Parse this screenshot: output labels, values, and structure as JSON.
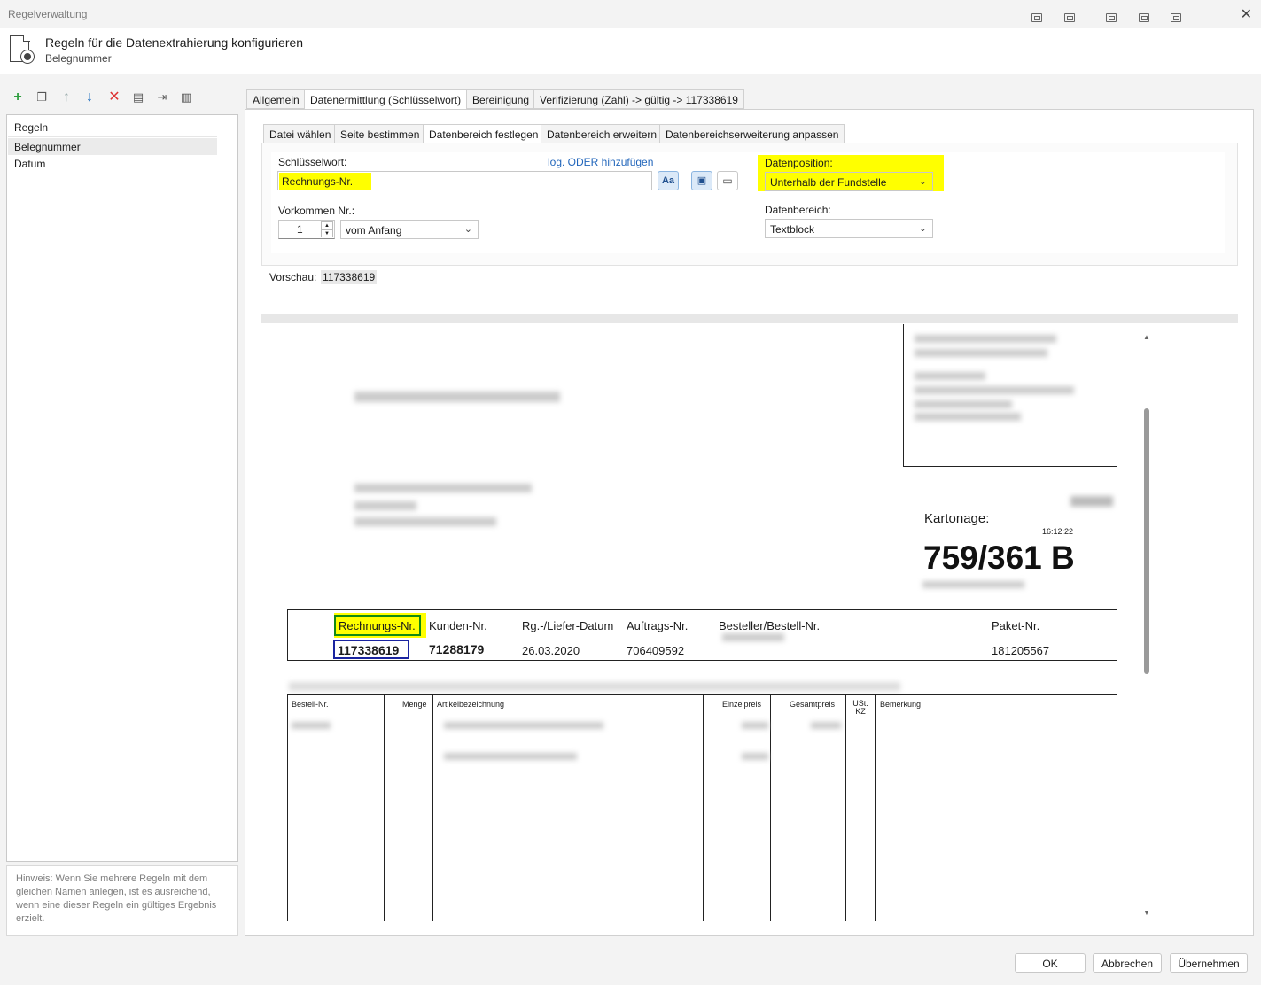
{
  "window": {
    "title": "Regelverwaltung",
    "header_title": "Regeln für die Datenextrahierung konfigurieren",
    "header_subtitle": "Belegnummer"
  },
  "left": {
    "list_header": "Regeln",
    "items": [
      "Belegnummer",
      "Datum"
    ],
    "hint": "Hinweis: Wenn Sie mehrere Regeln mit dem gleichen Namen anlegen, ist es ausreichend, wenn eine dieser Regeln ein gültiges Ergebnis erzielt."
  },
  "tabs": [
    "Allgemein",
    "Datenermittlung (Schlüsselwort)",
    "Bereinigung",
    "Verifizierung (Zahl) -> gültig -> 117338619"
  ],
  "subtabs": [
    "Datei wählen",
    "Seite bestimmen",
    "Datenbereich festlegen",
    "Datenbereich erweitern",
    "Datenbereichserweiterung anpassen"
  ],
  "form": {
    "keyword_label": "Schlüsselwort:",
    "keyword_value": "Rechnungs-Nr.",
    "or_link": "log. ODER hinzufügen",
    "case_btn": "Aa",
    "occurrence_label": "Vorkommen Nr.:",
    "occurrence_value": "1",
    "occurrence_from": "vom Anfang",
    "position_label": "Datenposition:",
    "position_value": "Unterhalb der Fundstelle",
    "area_label": "Datenbereich:",
    "area_value": "Textblock",
    "preview_label": "Vorschau:",
    "preview_value": "117338619"
  },
  "document": {
    "kartonage_label": "Kartonage:",
    "time": "16:12:22",
    "big_number": "759/361 B",
    "headers": [
      "Rechnungs-Nr.",
      "Kunden-Nr.",
      "Rg.-/Liefer-Datum",
      "Auftrags-Nr.",
      "Besteller/Bestell-Nr.",
      "Paket-Nr."
    ],
    "values": [
      "117338619",
      "71288179",
      "26.03.2020",
      "706409592",
      "",
      "181205567"
    ],
    "table_headers": [
      "Bestell-Nr.",
      "Menge",
      "Artikelbezeichnung",
      "Einzelpreis",
      "Gesamtpreis",
      "USt. KZ",
      "Bemerkung"
    ]
  },
  "buttons": {
    "ok": "OK",
    "cancel": "Abbrechen",
    "apply": "Übernehmen"
  },
  "colors": {
    "highlight": "#ffff00",
    "keyword_box": "#138a13",
    "value_box": "#1a24a0"
  }
}
